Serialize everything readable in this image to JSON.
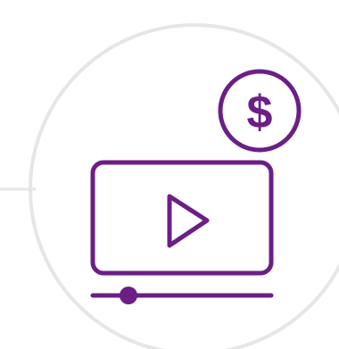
{
  "illustration": {
    "icon_name": "paid-video-icon",
    "currency_symbol": "$",
    "colors": {
      "accent": "#6B1F86",
      "ring": "#E6E6E6",
      "background": "#FFFFFF"
    },
    "progress_fraction": 0.2
  }
}
